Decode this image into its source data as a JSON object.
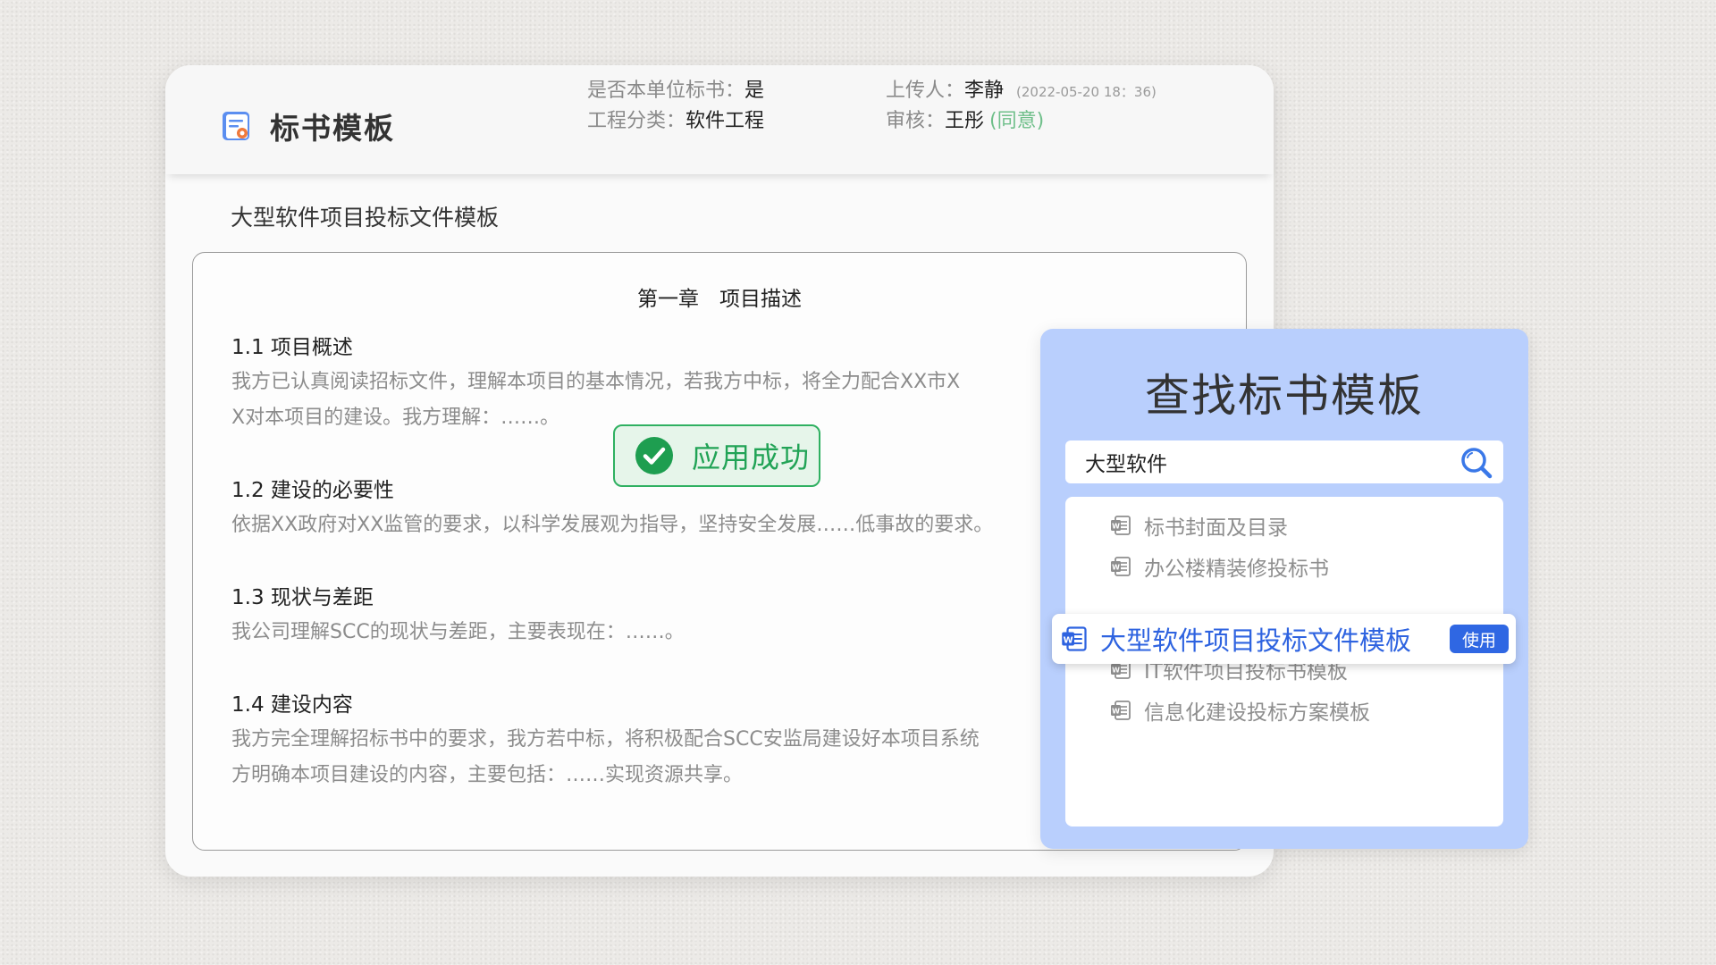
{
  "header": {
    "title": "标书模板",
    "is_own_unit_label": "是否本单位标书：",
    "is_own_unit_value": "是",
    "category_label": "工程分类：",
    "category_value": "软件工程",
    "uploader_label": "上传人：",
    "uploader_value": "李静",
    "upload_time": "(2022-05-20  18：36)",
    "reviewer_label": "审核：",
    "reviewer_value": "王彤",
    "review_status": "(同意)",
    "icon": "document-badge-icon"
  },
  "document": {
    "name": "大型软件项目投标文件模板",
    "chapter": "第一章　项目描述",
    "sections": [
      {
        "title": "1.1  项目概述",
        "lines": [
          "我方已认真阅读招标文件，理解本项目的基本情况，若我方中标，将全力配合XX市X",
          "X对本项目的建设。我方理解：……。"
        ]
      },
      {
        "title": "1.2  建设的必要性",
        "lines": [
          "依据XX政府对XX监管的要求，以科学发展观为指导，坚持安全发展……低事故的要求。"
        ]
      },
      {
        "title": "1.3  现状与差距",
        "lines": [
          "我公司理解SCC的现状与差距，主要表现在：……。"
        ]
      },
      {
        "title": "1.4  建设内容",
        "lines": [
          "我方完全理解招标书中的要求，我方若中标，将积极配合SCC安监局建设好本项目系统",
          "方明确本项目建设的内容，主要包括：……实现资源共享。"
        ]
      }
    ]
  },
  "toast": {
    "text": "应用成功",
    "icon": "check-circle-icon",
    "color": "#21a356"
  },
  "search": {
    "title": "查找标书模板",
    "query": "大型软件",
    "icon": "search-icon",
    "results": [
      {
        "label": "标书封面及目录",
        "icon": "word-doc-icon"
      },
      {
        "label": "办公楼精装修投标书",
        "icon": "word-doc-icon"
      },
      {
        "label": "IT软件项目投标书模板",
        "icon": "word-doc-icon"
      },
      {
        "label": "信息化建设投标方案模板",
        "icon": "word-doc-icon"
      }
    ],
    "selected": {
      "label": "大型软件项目投标文件模板",
      "icon": "word-doc-icon",
      "action": "使用"
    }
  },
  "colors": {
    "accent": "#2f67e3",
    "panel": "#b9cffd",
    "success": "#2fb061",
    "approve": "#6fbf8a"
  }
}
